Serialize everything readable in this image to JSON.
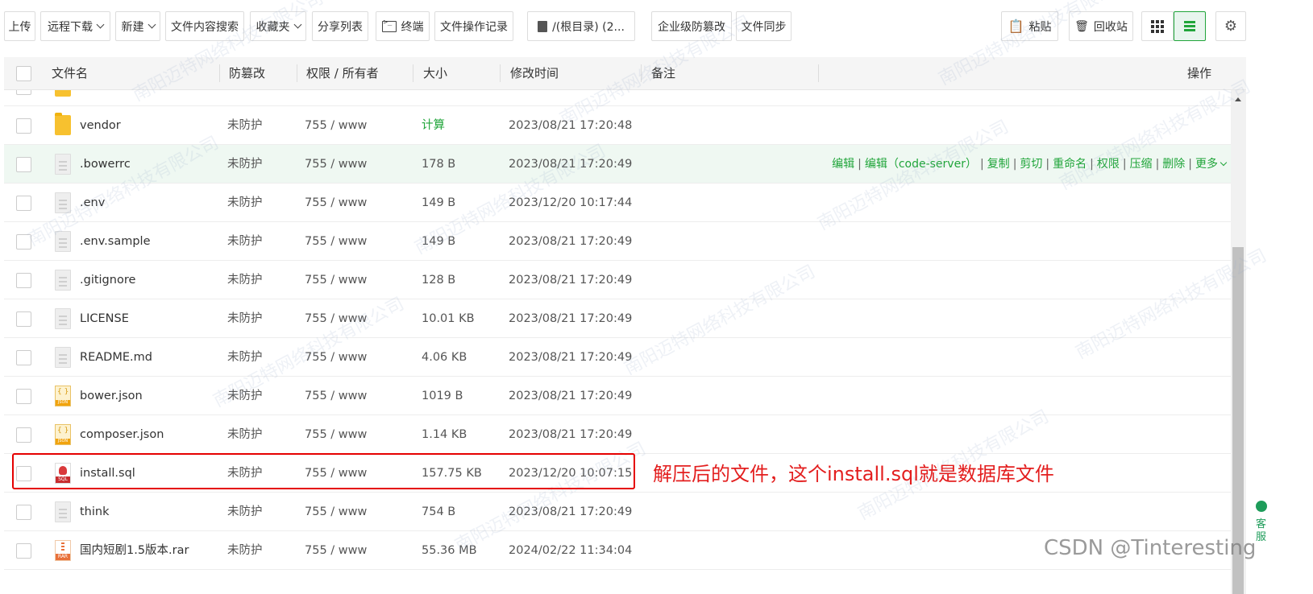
{
  "toolbar": {
    "upload": "上传",
    "remote_download": "远程下载",
    "new": "新建",
    "content_search": "文件内容搜索",
    "favorites": "收藏夹",
    "share_list": "分享列表",
    "terminal": "终端",
    "file_log": "文件操作记录",
    "path": "/(根目录) (2...",
    "tamper_proof": "企业级防篡改",
    "file_sync": "文件同步",
    "paste": "粘贴",
    "recycle_bin": "回收站"
  },
  "columns": {
    "name": "文件名",
    "tamper": "防篡改",
    "perm": "权限 / 所有者",
    "size": "大小",
    "mtime": "修改时间",
    "note": "备注",
    "ops": "操作"
  },
  "row_ops": {
    "edit": "编辑",
    "edit_code_server": "编辑（code-server）",
    "copy": "复制",
    "cut": "剪切",
    "rename": "重命名",
    "perm": "权限",
    "compress": "压缩",
    "delete": "删除",
    "more": "更多"
  },
  "files": [
    {
      "name": "vendor",
      "type": "folder",
      "tamper": "未防护",
      "perm": "755 / www",
      "size": "计算",
      "mtime": "2023/08/21 17:20:48"
    },
    {
      "name": ".bowerrc",
      "type": "doc",
      "tamper": "未防护",
      "perm": "755 / www",
      "size": "178 B",
      "mtime": "2023/08/21 17:20:49"
    },
    {
      "name": ".env",
      "type": "doc",
      "tamper": "未防护",
      "perm": "755 / www",
      "size": "149 B",
      "mtime": "2023/12/20 10:17:44"
    },
    {
      "name": ".env.sample",
      "type": "doc",
      "tamper": "未防护",
      "perm": "755 / www",
      "size": "149 B",
      "mtime": "2023/08/21 17:20:49"
    },
    {
      "name": ".gitignore",
      "type": "doc",
      "tamper": "未防护",
      "perm": "755 / www",
      "size": "128 B",
      "mtime": "2023/08/21 17:20:49"
    },
    {
      "name": "LICENSE",
      "type": "doc",
      "tamper": "未防护",
      "perm": "755 / www",
      "size": "10.01 KB",
      "mtime": "2023/08/21 17:20:49"
    },
    {
      "name": "README.md",
      "type": "doc",
      "tamper": "未防护",
      "perm": "755 / www",
      "size": "4.06 KB",
      "mtime": "2023/08/21 17:20:49"
    },
    {
      "name": "bower.json",
      "type": "json",
      "tamper": "未防护",
      "perm": "755 / www",
      "size": "1019 B",
      "mtime": "2023/08/21 17:20:49"
    },
    {
      "name": "composer.json",
      "type": "json",
      "tamper": "未防护",
      "perm": "755 / www",
      "size": "1.14 KB",
      "mtime": "2023/08/21 17:20:49"
    },
    {
      "name": "install.sql",
      "type": "sql",
      "tamper": "未防护",
      "perm": "755 / www",
      "size": "157.75 KB",
      "mtime": "2023/12/20 10:07:15"
    },
    {
      "name": "think",
      "type": "doc",
      "tamper": "未防护",
      "perm": "755 / www",
      "size": "754 B",
      "mtime": "2023/08/21 17:20:49"
    },
    {
      "name": "国内短剧1.5版本.rar",
      "type": "rar",
      "tamper": "未防护",
      "perm": "755 / www",
      "size": "55.36 MB",
      "mtime": "2024/02/22 11:34:04"
    }
  ],
  "annotation": "解压后的文件，这个install.sql就是数据库文件",
  "watermark": "南阳迈特网络科技有限公司",
  "credit": "CSDN @Tinteresting",
  "side_widget": "客服",
  "colors": {
    "accent": "#20a53a",
    "annotation": "#e31e1e"
  }
}
